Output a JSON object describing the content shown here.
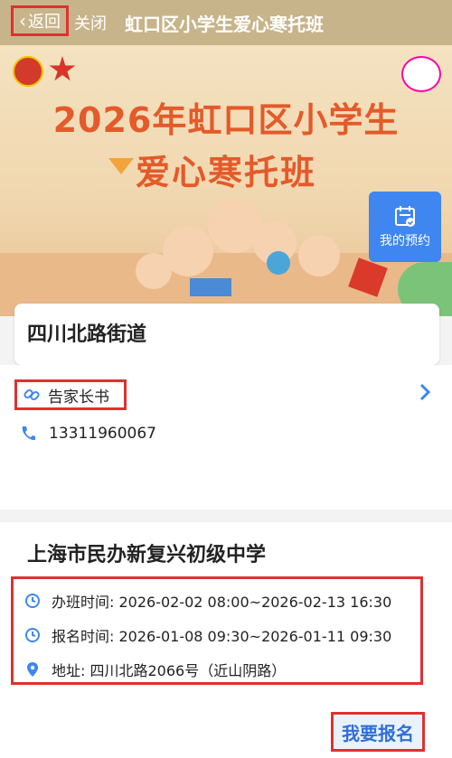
{
  "nav": {
    "back_label": "返回",
    "close_label": "关闭",
    "title": "虹口区小学生爱心寒托班"
  },
  "banner": {
    "title_line1": "2026年虹口区小学生",
    "title_line2": "爱心寒托班"
  },
  "reserve": {
    "label": "我的预约",
    "icon": "calendar-check-icon"
  },
  "district": {
    "name": "四川北路街道"
  },
  "notice": {
    "label": "告家长书",
    "icon": "link-icon"
  },
  "contact": {
    "phone": "13311960067",
    "icon": "phone-icon"
  },
  "school": {
    "name": "上海市民办新复兴初级中学",
    "class_time": "办班时间: 2026-02-02 08:00~2026-02-13 16:30",
    "signup_time": "报名时间: 2026-01-08 09:30~2026-01-11 09:30",
    "address": "地址: 四川北路2066号（近山阴路）"
  },
  "signup": {
    "label": "我要报名"
  },
  "colors": {
    "accent": "#3f86f0",
    "nav_bg": "#c8b48a",
    "highlight": "#e03030",
    "banner_title": "#e45a2a"
  }
}
